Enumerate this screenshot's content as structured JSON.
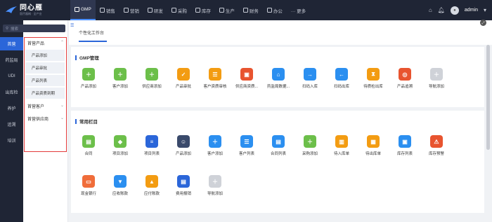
{
  "brand": {
    "name": "同心雁",
    "sub": "医疗器械 · 全产业"
  },
  "topnav": [
    {
      "label": "GMP",
      "active": true
    },
    {
      "label": "销售"
    },
    {
      "label": "营销"
    },
    {
      "label": "研发"
    },
    {
      "label": "采购"
    },
    {
      "label": "库存"
    },
    {
      "label": "生产"
    },
    {
      "label": "财务"
    },
    {
      "label": "办公"
    },
    {
      "label": "··· 更多"
    }
  ],
  "user": {
    "name": "admin"
  },
  "search_placeholder": "搜索",
  "leftnav": [
    {
      "label": "首营",
      "active": true
    },
    {
      "label": "药监局"
    },
    {
      "label": "UDI"
    },
    {
      "label": "出库检"
    },
    {
      "label": "养护"
    },
    {
      "label": "追溯"
    },
    {
      "label": "培训"
    }
  ],
  "submenu": {
    "groups": [
      "首营产品",
      "首营客户",
      "首营供应商"
    ],
    "children": [
      "产品添加",
      "产品审批",
      "产品列表",
      "产品资质到期"
    ]
  },
  "tab": {
    "label": "个性化工作台"
  },
  "gmp": {
    "title": "GMP管理",
    "items": [
      "产品添加",
      "客户添加",
      "供应商添加",
      "产品审批",
      "客户资质审核",
      "供应商资质...",
      "药监局数据...",
      "扫码入库",
      "扫码出库",
      "待质检出库",
      "产品追溯",
      "导航添加"
    ]
  },
  "common": {
    "title": "常用栏目",
    "row1": [
      "合同",
      "项目添加",
      "项目列表",
      "产品添加",
      "客户添加",
      "客户列表",
      "合同列表",
      "采购添加",
      "待入库单",
      "待出库单",
      "库存列表",
      "库存预警"
    ],
    "row2": [
      "现金银行",
      "应收账款",
      "应付账款",
      "费用报销",
      "导航添加"
    ]
  },
  "colors": {
    "accent": "#2b66d9",
    "dark": "#1f2535",
    "highlight": "#e33b3b"
  }
}
